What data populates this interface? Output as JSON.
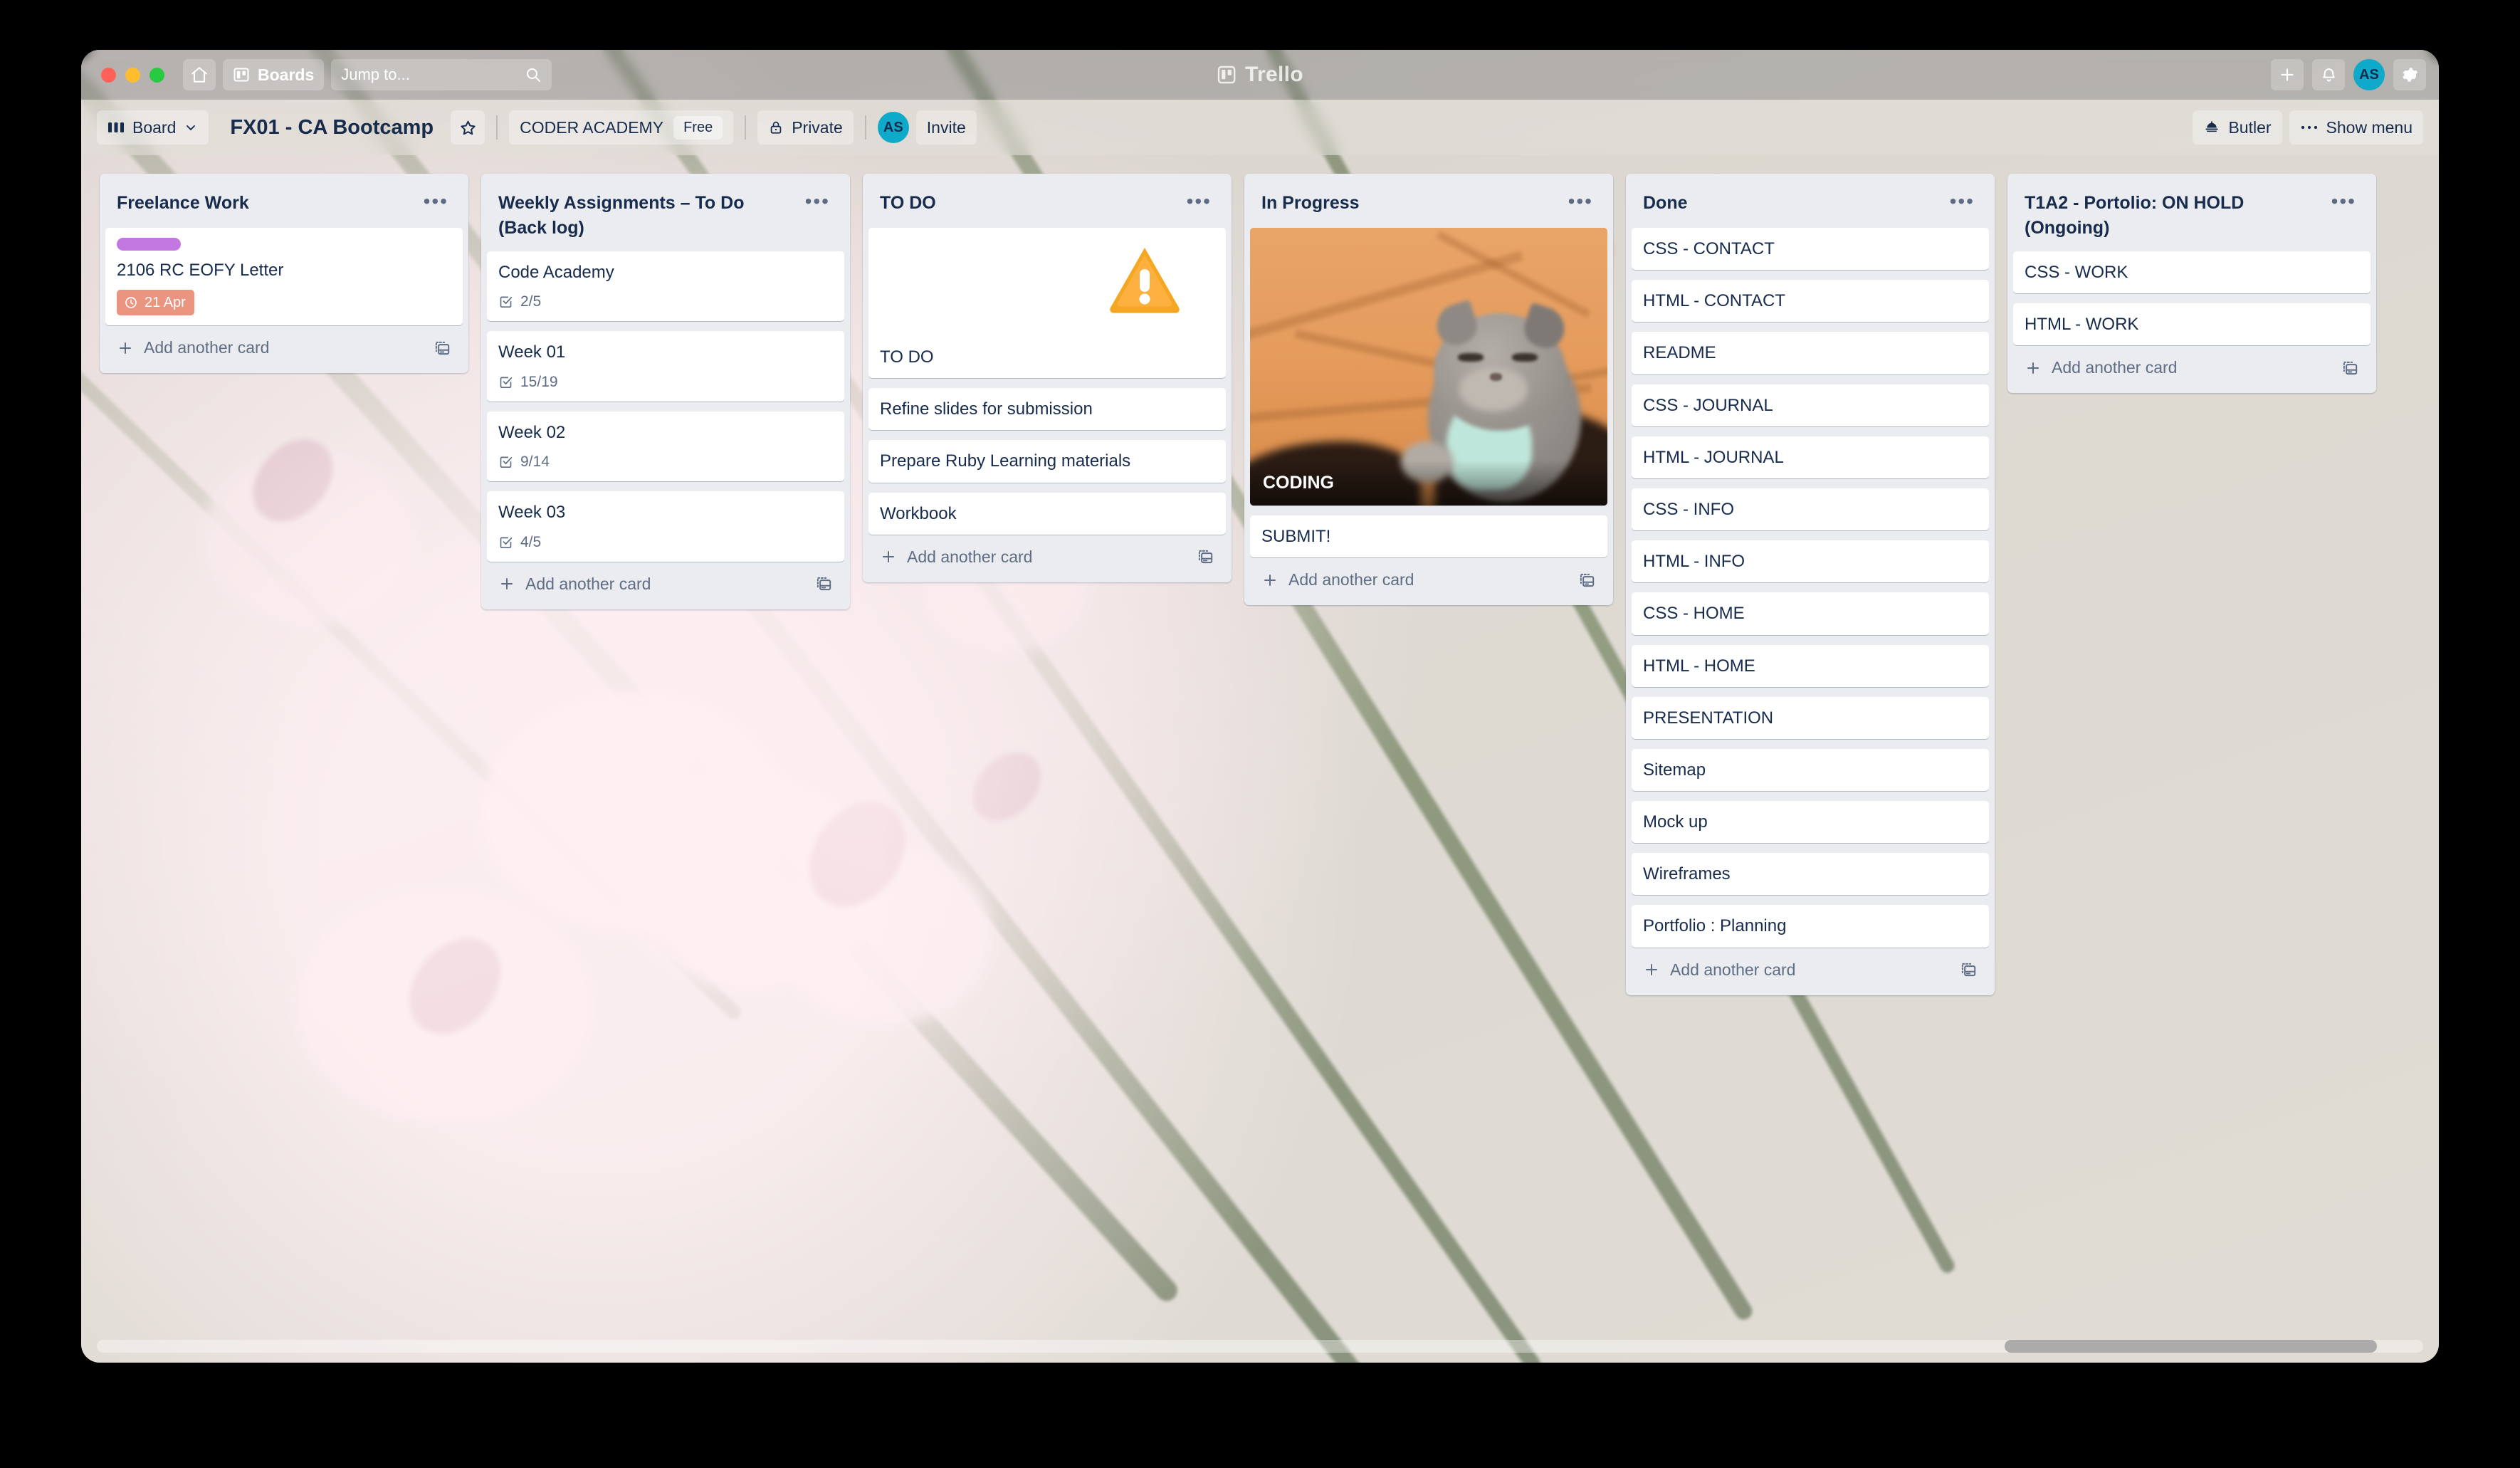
{
  "window": {
    "traffic_lights": [
      "close",
      "minimize",
      "zoom"
    ],
    "app_name": "Trello"
  },
  "topbar": {
    "home_icon": "home-icon",
    "boards_label": "Boards",
    "boards_icon": "board-icon",
    "search_placeholder": "Jump to...",
    "search_value": "",
    "search_icon": "search-icon",
    "logo_text": "Trello",
    "logo_icon": "trello-logo-icon",
    "add_icon": "plus-icon",
    "notifications_icon": "bell-icon",
    "avatar_initials": "AS",
    "settings_icon": "gear-icon",
    "avatar_color": "#0FA9C9"
  },
  "boardbar": {
    "view_label": "Board",
    "view_icon": "board-view-icon",
    "view_chevron": "chevron-down-icon",
    "title": "FX01 - CA Bootcamp",
    "star_icon": "star-icon",
    "org_name": "CODER ACADEMY",
    "plan_badge": "Free",
    "visibility_label": "Private",
    "visibility_icon": "lock-icon",
    "member_initials": "AS",
    "invite_label": "Invite",
    "butler_label": "Butler",
    "butler_icon": "butler-bell-icon",
    "show_menu_label": "Show menu",
    "show_menu_icon": "ellipsis-icon"
  },
  "lists": [
    {
      "title": "Freelance Work",
      "menu_icon": "list-menu-icon",
      "add_card_label": "Add another card",
      "add_card_icon": "plus-icon",
      "template_icon": "card-template-icon",
      "cards": [
        {
          "title": "2106 RC EOFY Letter",
          "label_color": "#C377E0",
          "due_date": "21 Apr",
          "due_icon": "clock-icon",
          "due_color": "#EB9480"
        }
      ]
    },
    {
      "title": "Weekly Assignments – To Do (Back log)",
      "menu_icon": "list-menu-icon",
      "add_card_label": "Add another card",
      "add_card_icon": "plus-icon",
      "template_icon": "card-template-icon",
      "cards": [
        {
          "title": "Code Academy",
          "checklist": "2/5",
          "checklist_icon": "checklist-icon"
        },
        {
          "title": "Week 01",
          "checklist": "15/19",
          "checklist_icon": "checklist-icon"
        },
        {
          "title": "Week 02",
          "checklist": "9/14",
          "checklist_icon": "checklist-icon"
        },
        {
          "title": "Week 03",
          "checklist": "4/5",
          "checklist_icon": "checklist-icon"
        }
      ]
    },
    {
      "title": "TO DO",
      "menu_icon": "list-menu-icon",
      "add_card_label": "Add another card",
      "add_card_icon": "plus-icon",
      "template_icon": "card-template-icon",
      "cards": [
        {
          "title": "TO DO",
          "cover": "warning-triangle-image"
        },
        {
          "title": "Refine slides for submission"
        },
        {
          "title": "Prepare Ruby Learning materials"
        },
        {
          "title": "Workbook"
        }
      ]
    },
    {
      "title": "In Progress",
      "menu_icon": "list-menu-icon",
      "add_card_label": "Add another card",
      "add_card_icon": "plus-icon",
      "template_icon": "card-template-icon",
      "cards": [
        {
          "title": "CODING",
          "cover": "kitten-photo-image"
        },
        {
          "title": "SUBMIT!"
        }
      ]
    },
    {
      "title": "Done",
      "menu_icon": "list-menu-icon",
      "add_card_label": "Add another card",
      "add_card_icon": "plus-icon",
      "template_icon": "card-template-icon",
      "cards": [
        {
          "title": "CSS - CONTACT"
        },
        {
          "title": "HTML - CONTACT"
        },
        {
          "title": "README"
        },
        {
          "title": "CSS - JOURNAL"
        },
        {
          "title": "HTML - JOURNAL"
        },
        {
          "title": "CSS - INFO"
        },
        {
          "title": "HTML - INFO"
        },
        {
          "title": "CSS - HOME"
        },
        {
          "title": "HTML - HOME"
        },
        {
          "title": "PRESENTATION"
        },
        {
          "title": "Sitemap"
        },
        {
          "title": "Mock up"
        },
        {
          "title": "Wireframes"
        },
        {
          "title": "Portfolio : Planning"
        }
      ]
    },
    {
      "title": "T1A2 - Portolio: ON HOLD (Ongoing)",
      "menu_icon": "list-menu-icon",
      "add_card_label": "Add another card",
      "add_card_icon": "plus-icon",
      "template_icon": "card-template-icon",
      "cards": [
        {
          "title": "CSS - WORK"
        },
        {
          "title": "HTML - WORK"
        }
      ]
    }
  ],
  "scrollbar": {
    "name": "horizontal-scrollbar"
  },
  "colors": {
    "list_bg": "#EBECF0",
    "card_bg": "#FFFFFF",
    "text_primary": "#172B4D",
    "text_muted": "#5E6C84",
    "board_bg": "#DCD8D1"
  }
}
